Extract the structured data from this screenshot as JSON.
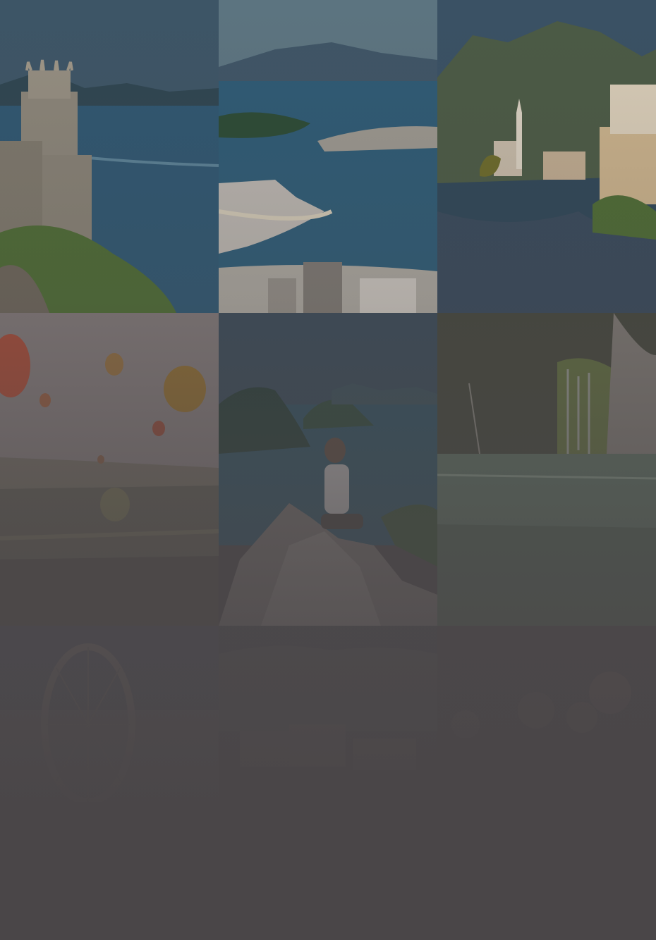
{
  "colors": {
    "background": "#4a4648",
    "overlay": "#4a4648"
  },
  "gallery": {
    "tiles": [
      {
        "subject": "castle-on-cliff-by-sea"
      },
      {
        "subject": "coastal-bay-city"
      },
      {
        "subject": "alpine-lake-village"
      },
      {
        "subject": "hot-air-balloons"
      },
      {
        "subject": "woman-on-rock-overlooking-islands"
      },
      {
        "subject": "waterfall-pool"
      },
      {
        "subject": "ferris-wheel"
      },
      {
        "subject": "hillside-town"
      },
      {
        "subject": "group-of-people"
      }
    ]
  }
}
